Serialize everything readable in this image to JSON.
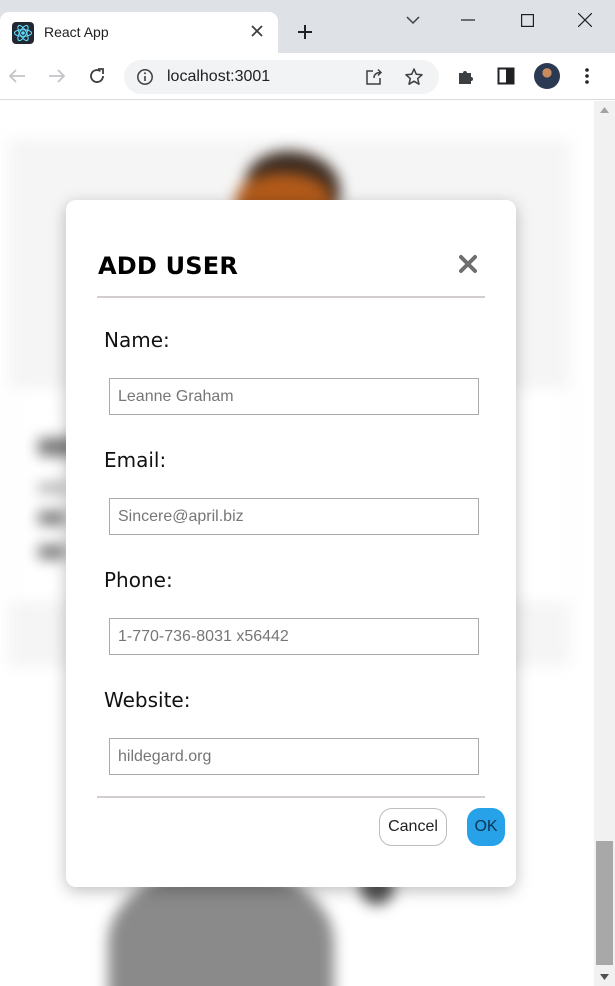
{
  "browser": {
    "tab_title": "React App",
    "url": "localhost:3001"
  },
  "modal": {
    "title": "ADD USER",
    "fields": [
      {
        "label": "Name:",
        "placeholder": "Leanne Graham"
      },
      {
        "label": "Email:",
        "placeholder": "Sincere@april.biz"
      },
      {
        "label": "Phone:",
        "placeholder": "1-770-736-8031 x56442"
      },
      {
        "label": "Website:",
        "placeholder": "hildegard.org"
      }
    ],
    "cancel_label": "Cancel",
    "ok_label": "OK"
  },
  "colors": {
    "ok_button": "#27a1e8",
    "divider": "#d3cdcd",
    "tabstrip": "#dee1e6"
  },
  "icons": {
    "tab": "react-logo-icon",
    "close": "close-icon",
    "new_tab": "plus-icon",
    "back": "arrow-left-icon",
    "forward": "arrow-right-icon",
    "reload": "reload-icon",
    "info": "info-icon",
    "share": "share-icon",
    "bookmark": "star-icon",
    "extensions": "puzzle-icon",
    "side_panel": "side-panel-icon",
    "menu": "kebab-menu-icon"
  }
}
